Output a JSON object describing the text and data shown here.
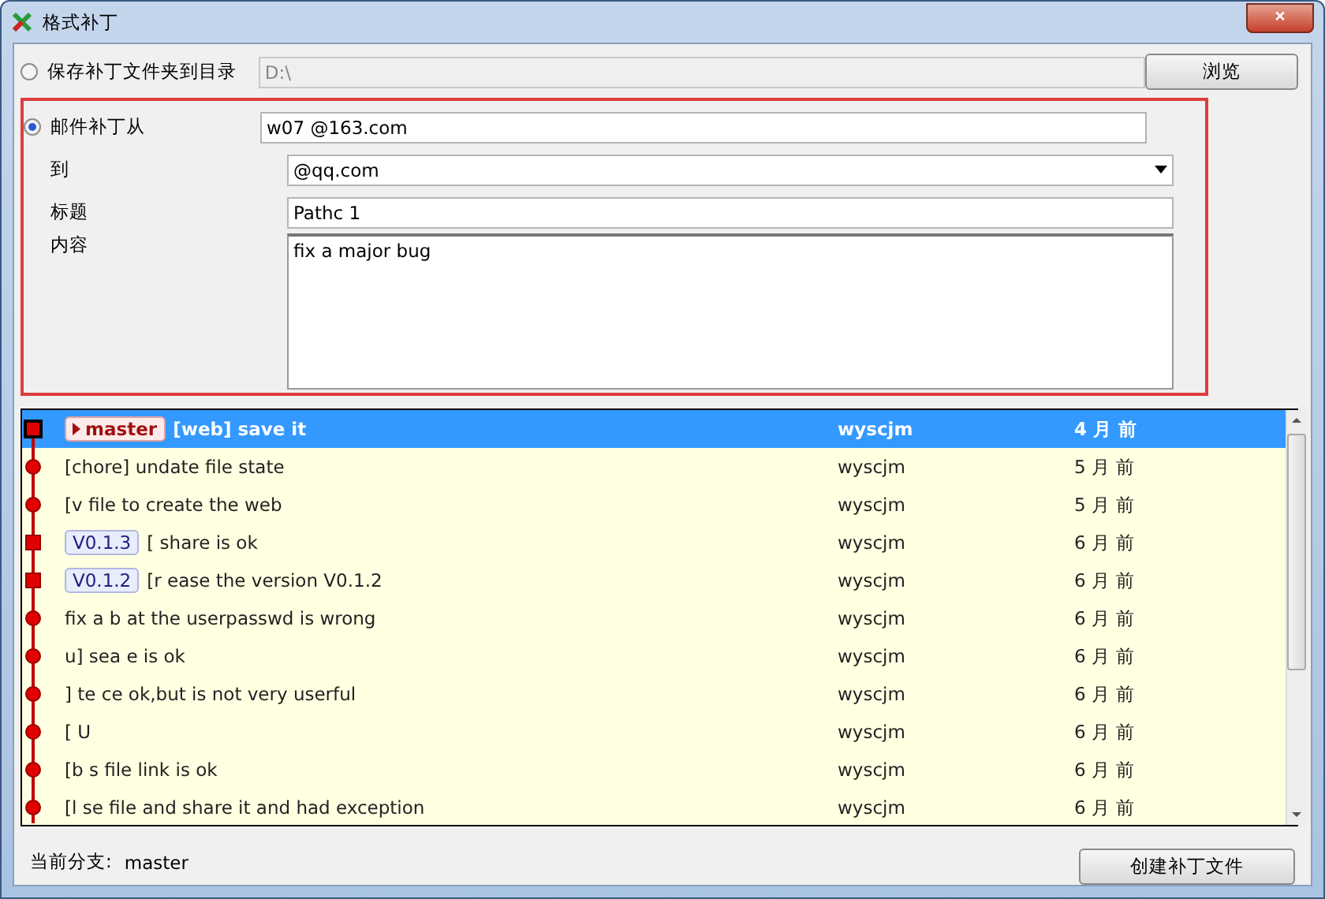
{
  "window": {
    "title": "格式补丁",
    "close": "×"
  },
  "save_option": {
    "label": "保存补丁文件夹到目录",
    "selected": false,
    "path": "D:\\",
    "button": "浏览"
  },
  "mail_option": {
    "label": "邮件补丁从",
    "selected": true,
    "from_value": "w07 @163.com",
    "to_label": "到",
    "to_value": "@qq.com",
    "subject_label": "标题",
    "subject_value": "Pathc 1",
    "body_label": "内容",
    "body_value": "fix a major bug"
  },
  "commits": [
    {
      "kind": "head",
      "ref": {
        "kind": "branch",
        "label": "master"
      },
      "message": "[web] save it",
      "author": "wyscjm",
      "date": "4 月 前",
      "selected": true
    },
    {
      "kind": "commit",
      "message": "[chore] undate file state",
      "author": "wyscjm",
      "date": "5 月 前",
      "selected": false
    },
    {
      "kind": "commit",
      "message": "[v file to create the web",
      "author": "wyscjm",
      "date": "5 月 前",
      "selected": false
    },
    {
      "kind": "tag",
      "ref": {
        "kind": "tag",
        "label": "V0.1.3"
      },
      "message": "[ share is ok",
      "author": "wyscjm",
      "date": "6 月 前",
      "selected": false
    },
    {
      "kind": "tag",
      "ref": {
        "kind": "tag",
        "label": "V0.1.2"
      },
      "message": "[r ease the version V0.1.2",
      "author": "wyscjm",
      "date": "6 月 前",
      "selected": false
    },
    {
      "kind": "commit",
      "message": "fix a b at the userpasswd is wrong",
      "author": "wyscjm",
      "date": "6 月 前",
      "selected": false
    },
    {
      "kind": "commit",
      "message": "u] sea e is ok",
      "author": "wyscjm",
      "date": "6 月 前",
      "selected": false
    },
    {
      "kind": "commit",
      "message": "] te ce ok,but is not very userful",
      "author": "wyscjm",
      "date": "6 月 前",
      "selected": false
    },
    {
      "kind": "commit",
      "message": "[ U",
      "author": "wyscjm",
      "date": "6 月 前",
      "selected": false
    },
    {
      "kind": "commit",
      "message": "[b s file link is ok",
      "author": "wyscjm",
      "date": "6 月 前",
      "selected": false
    },
    {
      "kind": "commit",
      "message": "[l se file and share it and had exception",
      "author": "wyscjm",
      "date": "6 月 前",
      "selected": false
    }
  ],
  "status": {
    "label": "当前分支:",
    "branch": "master"
  },
  "create_button": "创建补丁文件"
}
